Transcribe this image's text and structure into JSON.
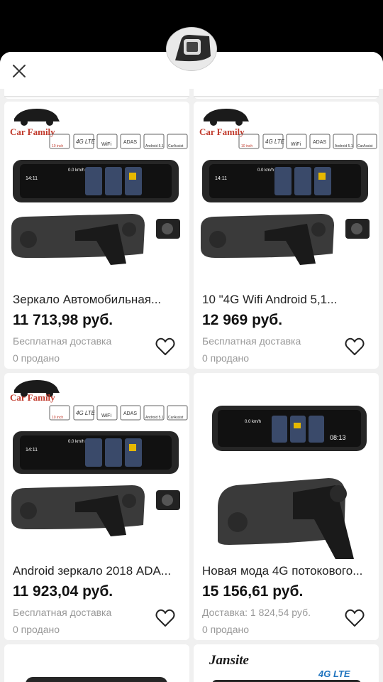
{
  "products": [
    {
      "title": "Зеркало Автомобильная...",
      "price": "11 713,98 руб.",
      "shipping": "Бесплатная доставка",
      "sold": "0 продано",
      "brand": "Car Family"
    },
    {
      "title": "10 \"4G Wifi Android 5,1...",
      "price": "12 969 руб.",
      "shipping": "Бесплатная доставка",
      "sold": "0 продано",
      "brand": "Car Family"
    },
    {
      "title": "Android зеркало 2018 ADA...",
      "price": "11 923,04 руб.",
      "shipping": "Бесплатная доставка",
      "sold": "0 продано",
      "brand": "Car Family"
    },
    {
      "title": "Новая мода 4G потокового...",
      "price": "15 156,61 руб.",
      "shipping": "Доставка: 1 824,54 руб.",
      "sold": "0 продано"
    }
  ],
  "badges": [
    "10 inch",
    "4G LTE",
    "WiFi",
    "ADAS",
    "Android 5.1",
    "CarAssist"
  ],
  "screen": {
    "time_a": "14:11",
    "speed": "0.0 km/h",
    "time_b": "08:13"
  },
  "bottom_cards": [
    {
      "brand": ""
    },
    {
      "brand": "Jansite",
      "badge": "4G LTE"
    }
  ]
}
